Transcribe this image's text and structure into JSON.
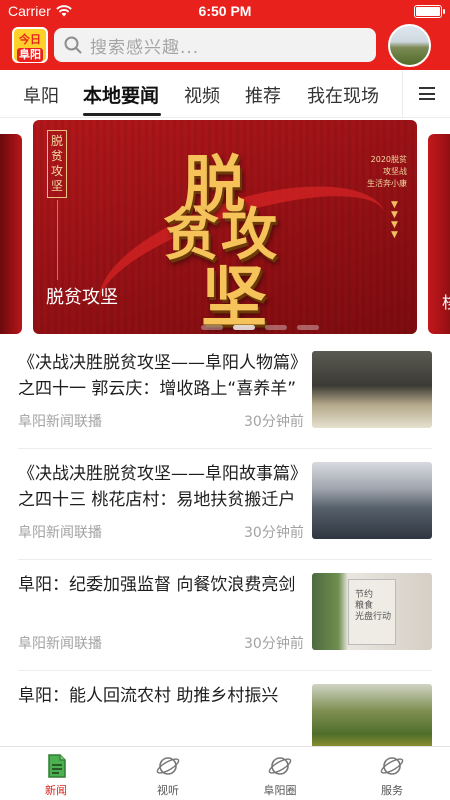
{
  "status_bar": {
    "carrier": "Carrier",
    "time": "6:50 PM"
  },
  "header": {
    "logo_line1": "今日",
    "logo_line2": "阜阳",
    "search_placeholder": "搜索感兴趣...",
    "brand_color": "#e8211d"
  },
  "tabs": [
    {
      "label": "阜阳",
      "active": false
    },
    {
      "label": "本地要闻",
      "active": true
    },
    {
      "label": "视频",
      "active": false
    },
    {
      "label": "推荐",
      "active": false
    },
    {
      "label": "我在现场",
      "active": false
    }
  ],
  "banner": {
    "headline_chars": [
      "脱",
      "贫攻",
      "坚"
    ],
    "side_vertical_text": "脱贫攻坚",
    "right_small_text": "2020脱贫\n攻坚战\n生活奔小康",
    "caption": "脱贫攻坚",
    "peek_right_text": "栘",
    "slide_count": 4,
    "active_slide": 2
  },
  "news": [
    {
      "title": "《决战决胜脱贫攻坚——阜阳人物篇》之四十一  郭云庆：增收路上“喜养羊”",
      "source": "阜阳新闻联播",
      "time": "30分钟前",
      "thumb": "people-at-desk-photo"
    },
    {
      "title": "《决战决胜脱贫攻坚——阜阳故事篇》之四十三   桃花店村：易地扶贫搬迁户",
      "source": "阜阳新闻联播",
      "time": "30分钟前",
      "thumb": "workshop-photo"
    },
    {
      "title": "阜阳：纪委加强监督 向餐饮浪费亮剑",
      "source": "阜阳新闻联播",
      "time": "30分钟前",
      "thumb": "poster-photo",
      "poster_text": "节约\n粮食\n光盘行动"
    },
    {
      "title": "阜阳：能人回流农村 助推乡村振兴",
      "source": "",
      "time": "",
      "thumb": "field-photo"
    }
  ],
  "bottom_nav": [
    {
      "label": "新闻",
      "icon": "news-icon",
      "active": true
    },
    {
      "label": "视听",
      "icon": "planet-icon",
      "active": false
    },
    {
      "label": "阜阳圈",
      "icon": "planet-icon",
      "active": false
    },
    {
      "label": "服务",
      "icon": "planet-icon",
      "active": false
    }
  ]
}
